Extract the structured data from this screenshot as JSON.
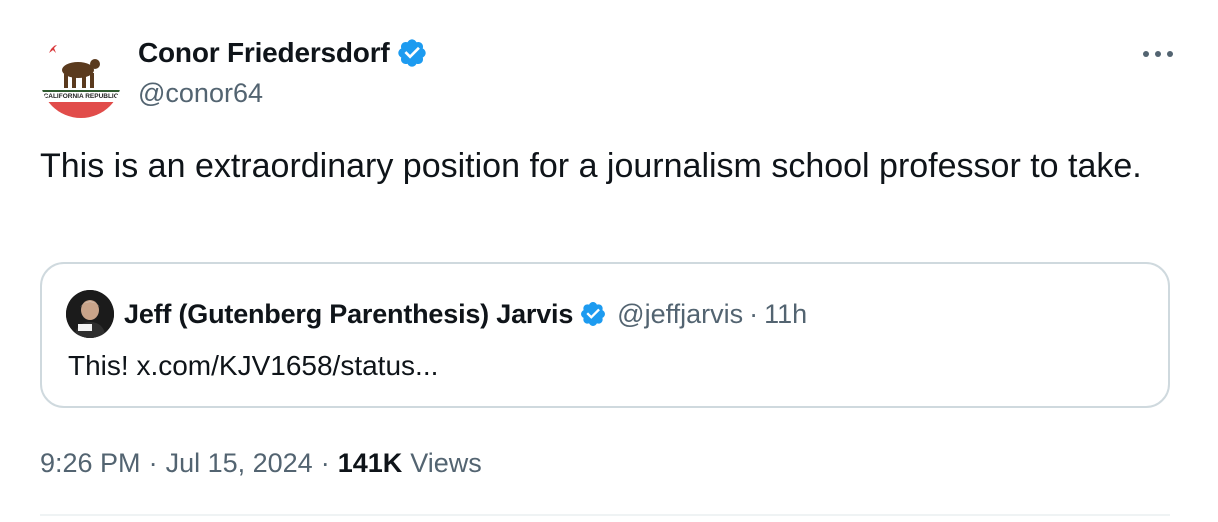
{
  "author": {
    "name": "Conor Friedersdorf",
    "handle": "@conor64",
    "avatar_text": "CALIFORNIA REPUBLIC"
  },
  "tweet": {
    "text": "This is an extraordinary position for a journalism school professor to take."
  },
  "quoted": {
    "name": "Jeff (Gutenberg Parenthesis) Jarvis",
    "handle": "@jeffjarvis",
    "separator": "·",
    "time": "11h",
    "text": "This! x.com/KJV1658/status..."
  },
  "meta": {
    "time": "9:26 PM",
    "dot": "·",
    "date": "Jul 15, 2024",
    "views_count": "141K",
    "views_label": "Views"
  },
  "colors": {
    "verified": "#1d9bf0",
    "secondary_text": "#536471",
    "border": "#cfd9de"
  },
  "icons": {
    "verified": "verified-badge-icon",
    "more": "more-options-icon"
  }
}
